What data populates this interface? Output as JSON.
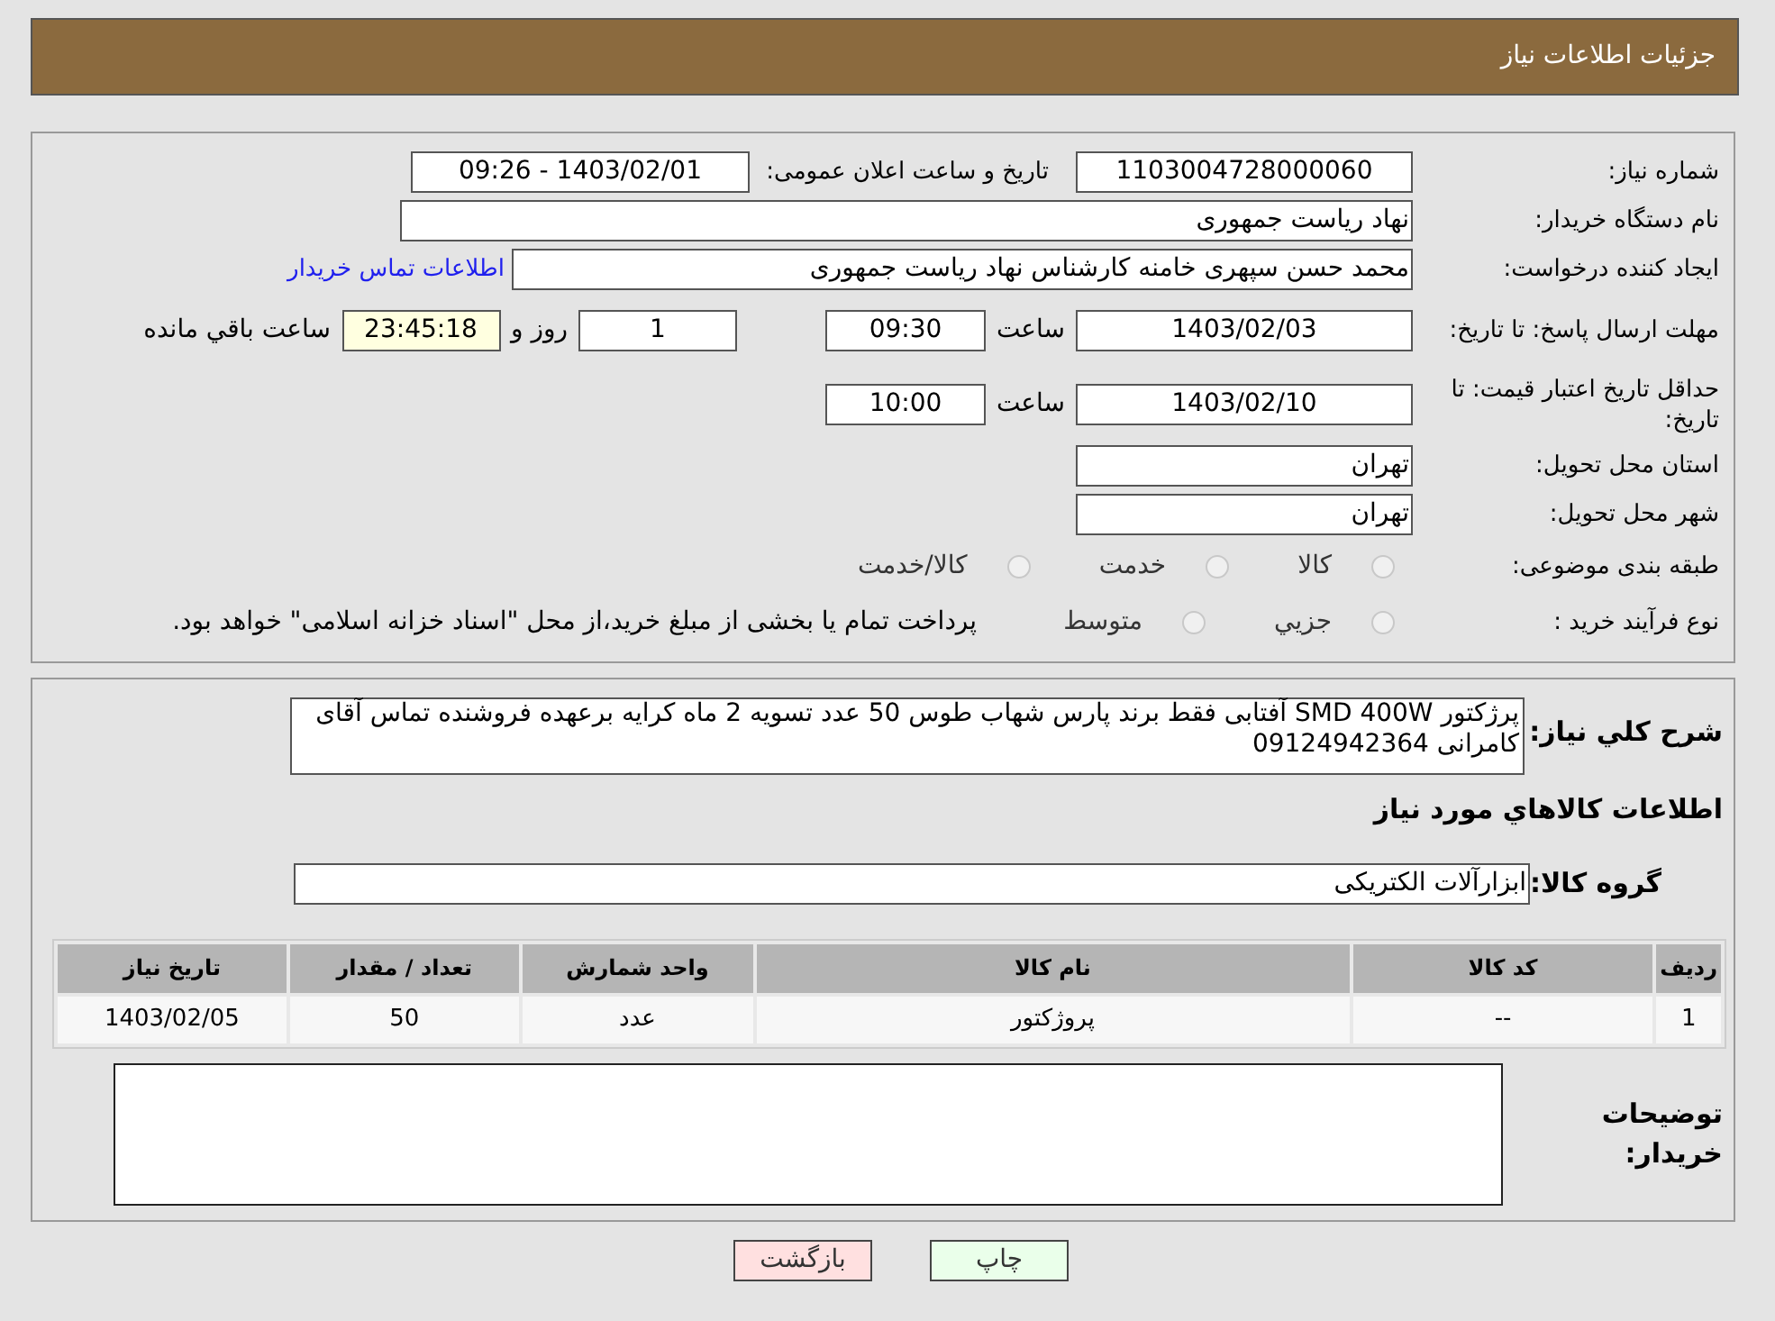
{
  "header": {
    "title": "جزئیات اطلاعات نیاز"
  },
  "need_number": {
    "label": "شماره نیاز:",
    "value": "1103004728000060"
  },
  "announce": {
    "label": "تاریخ و ساعت اعلان عمومی:",
    "value": "1403/02/01 - 09:26"
  },
  "buyer_org": {
    "label": "نام دستگاه خریدار:",
    "value": "نهاد ریاست جمهوری"
  },
  "requester": {
    "label": "ایجاد کننده درخواست:",
    "value": "محمد حسن سپهری خامنه کارشناس نهاد ریاست جمهوری",
    "link": "اطلاعات تماس خریدار"
  },
  "reply_deadline": {
    "label": "مهلت ارسال پاسخ: تا تاریخ:",
    "date": "1403/02/03",
    "time_label": "ساعت",
    "time": "09:30",
    "days": "1",
    "days_label": "روز و",
    "remaining": "23:45:18",
    "remaining_label": "ساعت باقي مانده"
  },
  "price_validity": {
    "label": "حداقل تاریخ اعتبار قیمت: تا تاریخ:",
    "date": "1403/02/10",
    "time_label": "ساعت",
    "time": "10:00"
  },
  "province": {
    "label": "استان محل تحویل:",
    "value": "تهران"
  },
  "city": {
    "label": "شهر محل تحویل:",
    "value": "تهران"
  },
  "category": {
    "label": "طبقه بندی موضوعی:",
    "options": [
      {
        "label": "کالا",
        "selected": false
      },
      {
        "label": "خدمت",
        "selected": false
      },
      {
        "label": "کالا/خدمت",
        "selected": false
      }
    ]
  },
  "purchase_type": {
    "label": "نوع فرآیند خرید :",
    "options": [
      {
        "label": "جزيي",
        "selected": false
      },
      {
        "label": "متوسط",
        "selected": false
      }
    ],
    "note": "پرداخت تمام یا بخشی از مبلغ خرید،از محل \"اسناد خزانه اسلامی\" خواهد بود."
  },
  "description": {
    "label": "شرح کلي نیاز:",
    "value": "پرژکتور SMD 400W آفتابی فقط برند پارس شهاب طوس 50 عدد تسویه 2 ماه کرایه برعهده فروشنده تماس آقای کامرانی 09124942364"
  },
  "goods_heading": "اطلاعات کالاهاي مورد نیاز",
  "goods_group": {
    "label": "گروه کالا:",
    "value": "ابزارآلات الکتریکی"
  },
  "table": {
    "columns": [
      "ردیف",
      "کد کالا",
      "نام کالا",
      "واحد شمارش",
      "تعداد / مقدار",
      "تاریخ نیاز"
    ],
    "rows": [
      [
        "1",
        "--",
        "پروژکتور",
        "عدد",
        "50",
        "1403/02/05"
      ]
    ]
  },
  "buyer_notes": {
    "label": "توضیحات خریدار:"
  },
  "buttons": [
    {
      "label": "چاپ",
      "kind": "print"
    },
    {
      "label": "بازگشت",
      "kind": "back"
    }
  ]
}
